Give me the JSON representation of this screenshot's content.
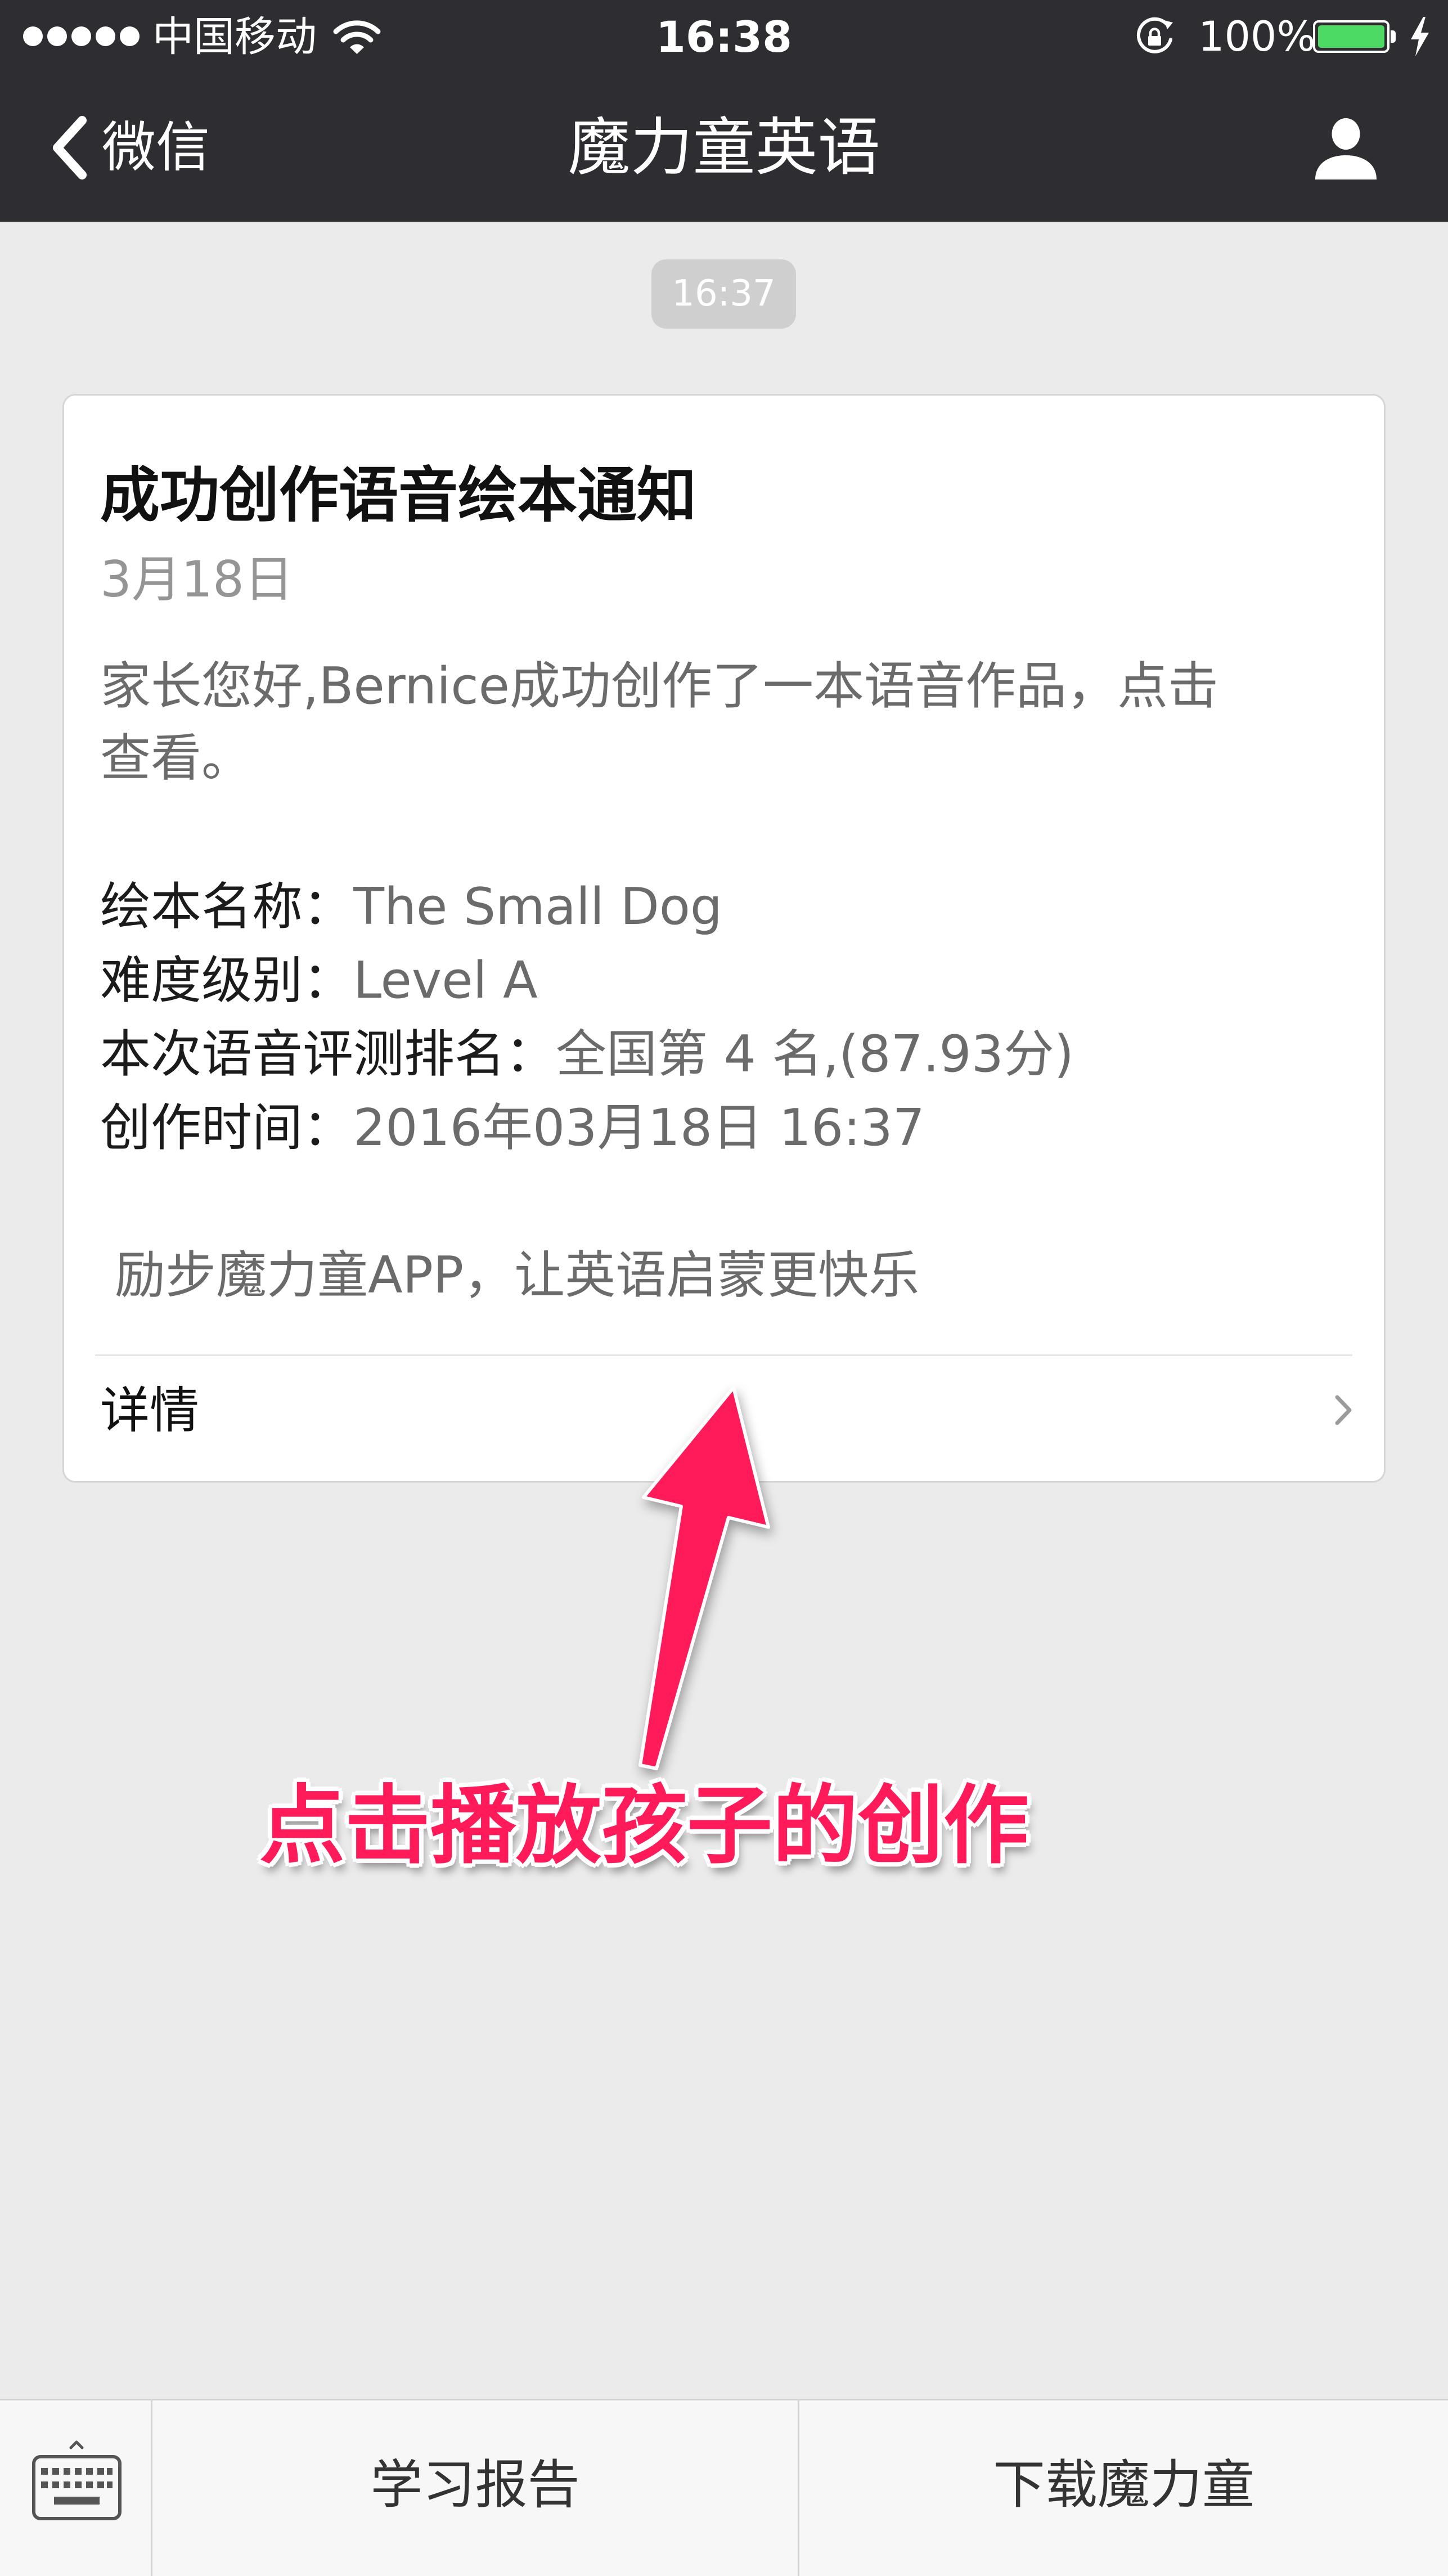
{
  "status_bar": {
    "carrier": "中国移动",
    "time": "16:38",
    "battery_percent": "100%",
    "battery_level": 1.0,
    "signal_strength": 5,
    "icons": [
      "signal-icon",
      "wifi-icon",
      "rotation-lock-icon",
      "battery-icon",
      "charging-icon"
    ]
  },
  "nav": {
    "back_label": "微信",
    "title": "魔力童英语",
    "back_icon": "chevron-left-icon",
    "profile_icon": "person-icon"
  },
  "chat": {
    "timestamp": "16:37",
    "card": {
      "title": "成功创作语音绘本通知",
      "date": "3月18日",
      "intro_lines": [
        "家长您好,Bernice成功创作了一本语音作品，点击",
        "查看。"
      ],
      "fields": [
        {
          "label": "绘本名称：",
          "value": "The Small Dog"
        },
        {
          "label": "难度级别：",
          "value": "Level A"
        },
        {
          "label": "本次语音评测排名：",
          "value": "全国第 4 名,(87.93分)"
        },
        {
          "label": "创作时间：",
          "value": "2016年03月18日 16:37"
        }
      ],
      "footer_note": "励步魔力童APP，让英语启蒙更快乐",
      "details_label": "详情",
      "details_icon": "chevron-right-icon"
    }
  },
  "annotation": {
    "text": "点击播放孩子的创作",
    "arrow_icon": "arrow-icon"
  },
  "bottom_menu": {
    "keyboard_icon": "keyboard-icon",
    "items": [
      "学习报告",
      "下载魔力童"
    ]
  },
  "colors": {
    "header_bg": "#2e2e32",
    "page_bg": "#ebebeb",
    "timestamp_bg": "#cfcfcf",
    "annotation": "#ff1b5a",
    "battery": "#4cd964"
  }
}
